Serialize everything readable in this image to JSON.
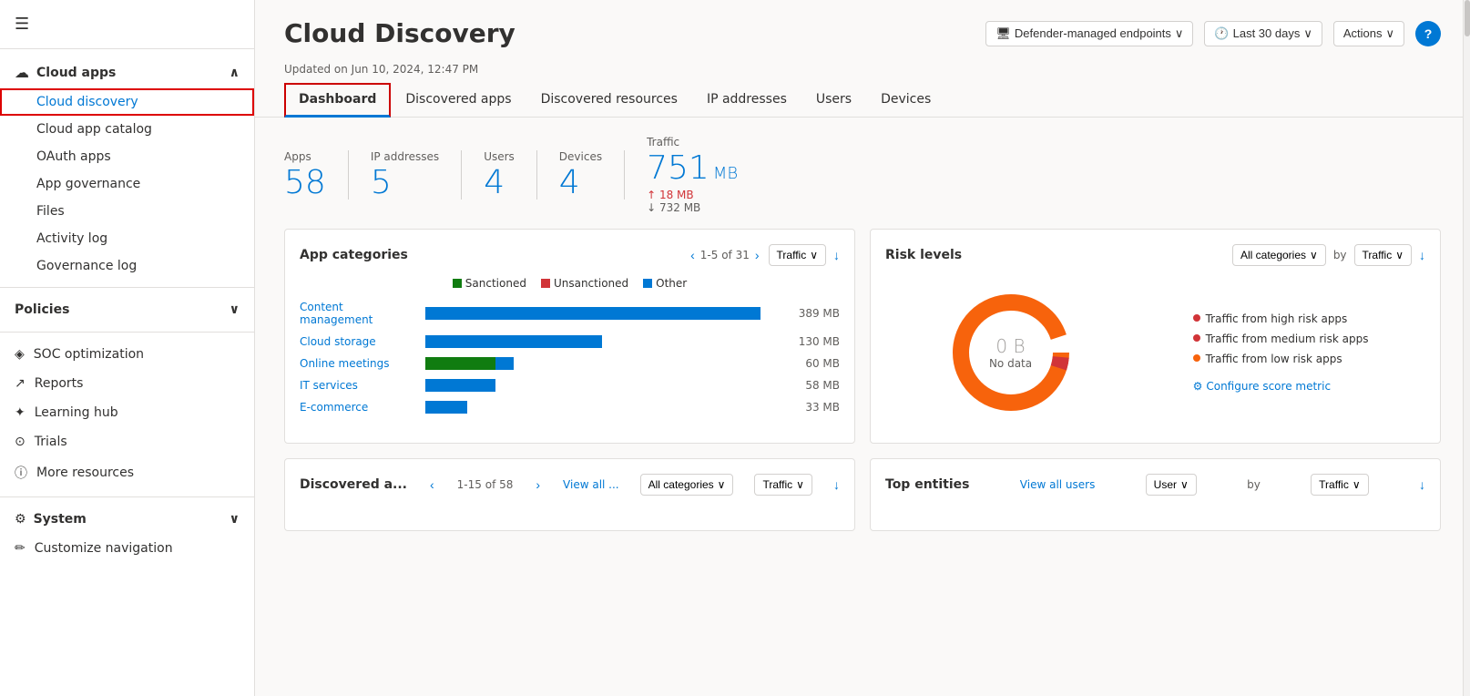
{
  "sidebar": {
    "hamburger_icon": "☰",
    "cloud_apps_label": "Cloud apps",
    "cloud_apps_chevron": "∧",
    "items": [
      {
        "id": "cloud-discovery",
        "label": "Cloud discovery",
        "active": true
      },
      {
        "id": "cloud-app-catalog",
        "label": "Cloud app catalog"
      },
      {
        "id": "oauth-apps",
        "label": "OAuth apps"
      },
      {
        "id": "app-governance",
        "label": "App governance"
      },
      {
        "id": "files",
        "label": "Files"
      },
      {
        "id": "activity-log",
        "label": "Activity log"
      },
      {
        "id": "governance-log",
        "label": "Governance log"
      }
    ],
    "policies_label": "Policies",
    "policies_chevron": "∨",
    "nav_items": [
      {
        "id": "soc-optimization",
        "icon": "◈",
        "label": "SOC optimization"
      },
      {
        "id": "reports",
        "icon": "↗",
        "label": "Reports"
      },
      {
        "id": "learning-hub",
        "icon": "✦",
        "label": "Learning hub"
      },
      {
        "id": "trials",
        "icon": "⊙",
        "label": "Trials"
      },
      {
        "id": "more-resources",
        "icon": "ⓘ",
        "label": "More resources"
      }
    ],
    "system_label": "System",
    "system_chevron": "∨",
    "customize_label": "Customize navigation"
  },
  "page": {
    "title": "Cloud Discovery",
    "updated_text": "Updated on Jun 10, 2024, 12:47 PM"
  },
  "header_controls": {
    "endpoints_label": "Defender-managed endpoints",
    "time_label": "Last 30 days",
    "actions_label": "Actions",
    "help_label": "?"
  },
  "tabs": [
    {
      "id": "dashboard",
      "label": "Dashboard",
      "active": true
    },
    {
      "id": "discovered-apps",
      "label": "Discovered apps"
    },
    {
      "id": "discovered-resources",
      "label": "Discovered resources"
    },
    {
      "id": "ip-addresses",
      "label": "IP addresses"
    },
    {
      "id": "users",
      "label": "Users"
    },
    {
      "id": "devices",
      "label": "Devices"
    }
  ],
  "stats": {
    "apps_label": "Apps",
    "apps_value": "58",
    "ip_addresses_label": "IP addresses",
    "ip_addresses_value": "5",
    "users_label": "Users",
    "users_value": "4",
    "devices_label": "Devices",
    "devices_value": "4",
    "traffic_label": "Traffic",
    "traffic_value": "751",
    "traffic_unit": "MB",
    "traffic_up_arrow": "↑",
    "traffic_up_value": "18 MB",
    "traffic_down_arrow": "↓",
    "traffic_down_value": "732 MB"
  },
  "app_categories": {
    "title": "App categories",
    "pagination": "1-5 of 31",
    "filter_label": "Traffic",
    "legend": [
      {
        "color": "#107c10",
        "label": "Sanctioned"
      },
      {
        "color": "#d13438",
        "label": "Unsanctioned"
      },
      {
        "color": "#0078d4",
        "label": "Other"
      }
    ],
    "bars": [
      {
        "label": "Content management",
        "sanctioned": 0,
        "unsanctioned": 0,
        "other": 95,
        "value": "389 MB",
        "total_pct": 95
      },
      {
        "label": "Cloud storage",
        "sanctioned": 0,
        "unsanctioned": 0,
        "other": 50,
        "value": "130 MB",
        "total_pct": 50
      },
      {
        "label": "Online meetings",
        "sanctioned": 20,
        "unsanctioned": 0,
        "other": 5,
        "value": "60 MB",
        "total_pct": 25
      },
      {
        "label": "IT services",
        "sanctioned": 0,
        "unsanctioned": 0,
        "other": 20,
        "value": "58 MB",
        "total_pct": 20
      },
      {
        "label": "E-commerce",
        "sanctioned": 0,
        "unsanctioned": 0,
        "other": 12,
        "value": "33 MB",
        "total_pct": 12
      }
    ]
  },
  "risk_levels": {
    "title": "Risk levels",
    "filter_label": "All categories",
    "by_label": "by",
    "by_filter": "Traffic",
    "donut_value": "0 B",
    "donut_label": "No data",
    "legend": [
      {
        "color": "#d13438",
        "label": "Traffic from high risk apps"
      },
      {
        "color": "#d13438",
        "label": "Traffic from medium risk apps"
      },
      {
        "color": "#f7630c",
        "label": "Traffic from low risk apps"
      }
    ],
    "configure_label": "Configure score metric"
  },
  "discovered_apps": {
    "title": "Discovered a...",
    "pagination": "1-15 of 58",
    "view_all_label": "View all ...",
    "filter_label": "All categories",
    "by_filter": "Traffic"
  },
  "top_entities": {
    "title": "Top entities",
    "view_all_label": "View all users",
    "filter_label": "User",
    "by_label": "by",
    "by_filter": "Traffic"
  }
}
